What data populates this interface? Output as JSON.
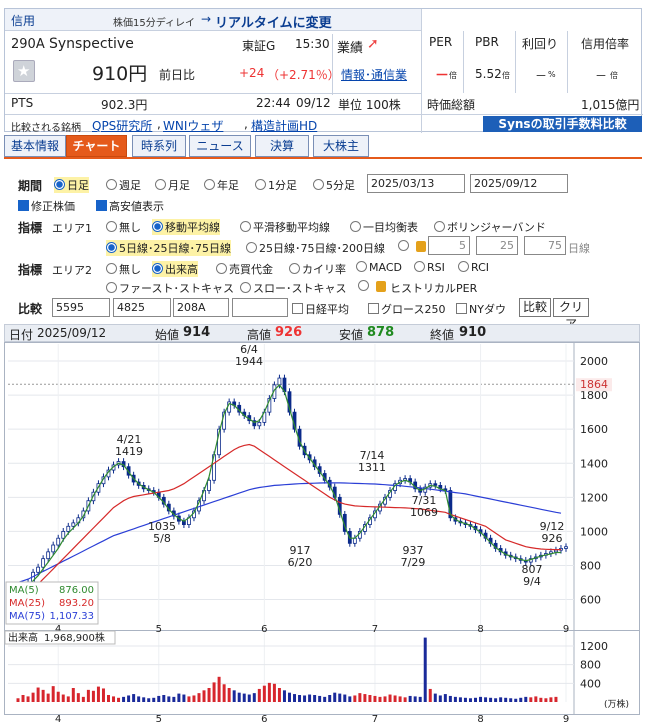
{
  "header": {
    "category": "信用",
    "delay_note": "株価15分ディレイ",
    "realtime_link": "リアルタイムに変更",
    "code": "290A",
    "name": "Synspective",
    "market": "東証G",
    "time": "15:30",
    "gyoseki_label": "業績",
    "price": "910円",
    "prev_label": "前日比",
    "change": "+24",
    "change_pct": "（+2.71％）",
    "info_link": "情報･通信業",
    "pts_label": "PTS",
    "pts_price": "902.3円",
    "pts_time": "22:44",
    "pts_date": "09/12",
    "unit": "単位 100株",
    "per_label": "PER",
    "per_value": "－",
    "per_unit": "倍",
    "pbr_label": "PBR",
    "pbr_value": "5.52",
    "pbr_unit": "倍",
    "yield_label": "利回り",
    "yield_value": "－",
    "yield_unit": "%",
    "margin_label": "信用倍率",
    "margin_value": "－",
    "margin_unit": "倍",
    "mcap_label": "時価総額",
    "mcap_value": "1,015億円",
    "compare_label": "比較される銘柄",
    "compare_links": [
      "QPS研究所",
      "WNIウェザ",
      "構造計画HD"
    ],
    "fee_banner": "Synsの取引手数料比較"
  },
  "tabs": [
    {
      "label": "基本情報"
    },
    {
      "label": "チャート"
    },
    {
      "label": "時系列"
    },
    {
      "label": "ニュース"
    },
    {
      "label": "決算"
    },
    {
      "label": "大株主"
    }
  ],
  "controls": {
    "period_label": "期間",
    "period_options": [
      "日足",
      "週足",
      "月足",
      "年足",
      "1分足",
      "5分足"
    ],
    "date_from": "2025/03/13",
    "date_to": "2025/09/12",
    "adjusted": "修正株価",
    "high_low": "高安値表示",
    "indicator_label": "指標",
    "area1": "エリア1",
    "area1_options": [
      "無し",
      "移動平均線",
      "平滑移動平均線",
      "一目均衡表",
      "ボリンジャーバンド"
    ],
    "ma_options": [
      "5日線･25日線･75日線",
      "25日線･75日線･200日線"
    ],
    "custom_ma": [
      "5",
      "25",
      "75"
    ],
    "custom_unit": "日線",
    "area2": "エリア2",
    "area2_options": [
      "無し",
      "出来高",
      "売買代金",
      "カイリ率",
      "MACD",
      "RSI",
      "RCI"
    ],
    "area2_options_row2": [
      "ファースト･ストキャス",
      "スロー･ストキャス",
      "ヒストリカルPER"
    ],
    "compare_label": "比較",
    "compare_codes": [
      "5595",
      "4825",
      "208A",
      ""
    ],
    "compare_checks": [
      "日経平均",
      "グロース250",
      "NYダウ"
    ],
    "compare_button": "比較",
    "clear_button": "クリア"
  },
  "ohlc_bar": {
    "date_label": "日付",
    "date": "2025/09/12",
    "open_label": "始値",
    "open": "914",
    "high_label": "高値",
    "high": "926",
    "low_label": "安値",
    "low": "878",
    "close_label": "終値",
    "close": "910"
  },
  "chart_data": {
    "type": "candlestick",
    "y_ticks": [
      "2000",
      "1800",
      "1600",
      "1400",
      "1200",
      "1000",
      "800",
      "600"
    ],
    "y_range": [
      480,
      2100
    ],
    "highlight_price": "1864",
    "x_ticks": [
      "4",
      "5",
      "6",
      "7",
      "8",
      "9"
    ],
    "annotations": [
      {
        "text": "4/21",
        "value": "1419"
      },
      {
        "text": "6/4",
        "value": "1944"
      },
      {
        "text": "1035",
        "value": "5/8"
      },
      {
        "text": "917",
        "value": "6/20"
      },
      {
        "text": "7/14",
        "value": "1311"
      },
      {
        "text": "7/31",
        "value": "1069"
      },
      {
        "text": "937",
        "value": "7/29"
      },
      {
        "text": "807",
        "value": "9/4"
      },
      {
        "text": "9/12",
        "value": "926"
      }
    ],
    "legend": [
      {
        "name": "MA(5)",
        "value": "876.00",
        "color": "#2f8a2f"
      },
      {
        "name": "MA(25)",
        "value": "893.20",
        "color": "#d62a2a"
      },
      {
        "name": "MA(75)",
        "value": "1,107.33",
        "color": "#2b3fd6"
      }
    ],
    "closes": [
      650,
      680,
      700,
      760,
      790,
      840,
      880,
      920,
      960,
      1000,
      1030,
      1050,
      1080,
      1120,
      1180,
      1230,
      1280,
      1320,
      1360,
      1390,
      1410,
      1380,
      1330,
      1290,
      1270,
      1250,
      1240,
      1230,
      1200,
      1160,
      1120,
      1090,
      1060,
      1040,
      1080,
      1120,
      1180,
      1240,
      1300,
      1450,
      1600,
      1700,
      1760,
      1740,
      1700,
      1680,
      1650,
      1620,
      1640,
      1700,
      1780,
      1860,
      1900,
      1820,
      1700,
      1600,
      1500,
      1450,
      1420,
      1380,
      1340,
      1300,
      1260,
      1200,
      1100,
      1000,
      930,
      960,
      1000,
      1040,
      1080,
      1120,
      1160,
      1200,
      1240,
      1280,
      1300,
      1310,
      1290,
      1250,
      1230,
      1260,
      1280,
      1270,
      1250,
      1240,
      1080,
      1060,
      1050,
      1040,
      1030,
      1010,
      990,
      960,
      930,
      900,
      880,
      860,
      850,
      840,
      830,
      820,
      840,
      850,
      860,
      870,
      880,
      890,
      900,
      910
    ],
    "ma5": [
      640,
      660,
      680,
      710,
      740,
      780,
      820,
      860,
      900,
      950,
      990,
      1020,
      1050,
      1090,
      1150,
      1210,
      1260,
      1310,
      1350,
      1380,
      1400,
      1390,
      1350,
      1310,
      1280,
      1260,
      1245,
      1230,
      1200,
      1170,
      1130,
      1100,
      1075,
      1060,
      1080,
      1110,
      1170,
      1240,
      1320,
      1450,
      1580,
      1690,
      1750,
      1740,
      1710,
      1680,
      1660,
      1640,
      1650,
      1700,
      1770,
      1830,
      1860,
      1820,
      1720,
      1620,
      1530,
      1470,
      1430,
      1390,
      1350,
      1310,
      1270,
      1210,
      1120,
      1030,
      960,
      960,
      990,
      1030,
      1070,
      1110,
      1150,
      1190,
      1230,
      1270,
      1290,
      1300,
      1290,
      1260,
      1240,
      1250,
      1270,
      1265,
      1250,
      1240,
      1100,
      1070,
      1055,
      1045,
      1035,
      1015,
      995,
      965,
      935,
      905,
      885,
      865,
      855,
      845,
      835,
      828,
      835,
      845,
      855,
      862,
      868,
      876,
      876
    ],
    "ma25": [
      600,
      620,
      640,
      660,
      690,
      720,
      750,
      780,
      810,
      840,
      870,
      900,
      930,
      960,
      990,
      1020,
      1050,
      1080,
      1110,
      1140,
      1160,
      1180,
      1195,
      1205,
      1210,
      1215,
      1220,
      1225,
      1230,
      1235,
      1240,
      1250,
      1265,
      1280,
      1300,
      1320,
      1340,
      1360,
      1380,
      1400,
      1420,
      1440,
      1460,
      1480,
      1495,
      1505,
      1510,
      1500,
      1480,
      1460,
      1440,
      1420,
      1400,
      1380,
      1360,
      1340,
      1320,
      1300,
      1280,
      1260,
      1240,
      1220,
      1200,
      1185,
      1170,
      1160,
      1155,
      1150,
      1148,
      1146,
      1145,
      1144,
      1143,
      1142,
      1141,
      1140,
      1139,
      1138,
      1136,
      1134,
      1132,
      1128,
      1124,
      1120,
      1116,
      1112,
      1100,
      1090,
      1080,
      1070,
      1060,
      1050,
      1040,
      1030,
      1010,
      990,
      970,
      950,
      940,
      930,
      920,
      910,
      905,
      900,
      897,
      895,
      894,
      893,
      893
    ],
    "ma75": [
      700,
      710,
      720,
      735,
      750,
      765,
      780,
      795,
      810,
      825,
      840,
      855,
      870,
      885,
      900,
      915,
      930,
      945,
      960,
      975,
      985,
      995,
      1005,
      1015,
      1025,
      1035,
      1045,
      1055,
      1065,
      1075,
      1085,
      1095,
      1105,
      1115,
      1125,
      1135,
      1145,
      1155,
      1165,
      1175,
      1185,
      1195,
      1205,
      1215,
      1225,
      1235,
      1245,
      1252,
      1258,
      1262,
      1266,
      1270,
      1272,
      1274,
      1276,
      1278,
      1280,
      1281,
      1282,
      1283,
      1284,
      1285,
      1285,
      1285,
      1285,
      1284,
      1283,
      1282,
      1281,
      1280,
      1279,
      1278,
      1276,
      1274,
      1272,
      1270,
      1268,
      1265,
      1262,
      1259,
      1256,
      1252,
      1248,
      1244,
      1240,
      1236,
      1232,
      1228,
      1224,
      1220,
      1214,
      1208,
      1202,
      1196,
      1190,
      1184,
      1178,
      1172,
      1166,
      1160,
      1154,
      1148,
      1142,
      1136,
      1130,
      1124,
      1118,
      1112,
      1107
    ],
    "volume_label": "出来高",
    "volume_value": "1,968,900株",
    "volume_unit": "(万株)",
    "volume_ticks": [
      "1200",
      "800",
      "400"
    ],
    "volumes": [
      80,
      150,
      120,
      200,
      310,
      260,
      180,
      340,
      220,
      160,
      120,
      300,
      190,
      110,
      260,
      240,
      330,
      290,
      150,
      120,
      90,
      110,
      140,
      170,
      120,
      100,
      80,
      90,
      130,
      150,
      120,
      110,
      180,
      160,
      120,
      140,
      190,
      250,
      300,
      420,
      540,
      380,
      300,
      250,
      200,
      180,
      160,
      190,
      280,
      350,
      410,
      390,
      300,
      250,
      200,
      170,
      150,
      140,
      160,
      150,
      130,
      110,
      150,
      200,
      180,
      160,
      120,
      140,
      190,
      170,
      150,
      130,
      110,
      120,
      160,
      140,
      120,
      100,
      130,
      120,
      110,
      1380,
      280,
      180,
      140,
      170,
      130,
      110,
      100,
      90,
      80,
      90,
      110,
      100,
      90,
      80,
      100,
      90,
      80,
      70,
      90,
      110,
      100,
      120,
      90,
      80,
      100,
      110
    ]
  }
}
